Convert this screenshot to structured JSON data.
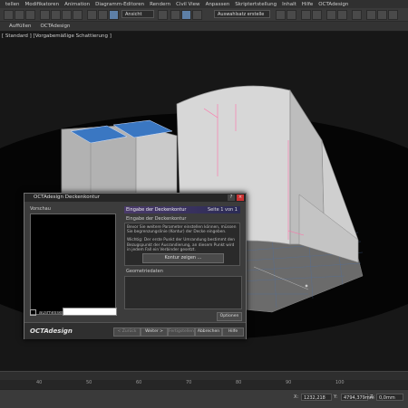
{
  "menubar": {
    "items": [
      "tellen",
      "Modifikatoren",
      "Animation",
      "Diagramm-Editoren",
      "Rendern",
      "Civil View",
      "Anpassen",
      "Skriptertstellung",
      "Inhalt",
      "Hilfe",
      "OCTAdesign"
    ]
  },
  "toolbar": {
    "view_select": "Ansicht",
    "selection_set": "Auswahlsatz erstelle"
  },
  "tabs": {
    "items": [
      "Auffüllen",
      "OCTAdesign"
    ]
  },
  "viewport": {
    "label": "[ Standard ] [Vorgabemäßige Schattierung ]"
  },
  "timeline": {
    "ticks": [
      "40",
      "50",
      "60",
      "70",
      "80",
      "90",
      "100"
    ]
  },
  "status": {
    "x_label": "X:",
    "x_value": "1232,218",
    "y_label": "Y:",
    "y_value": "4794,379mm",
    "z_label": "Z:",
    "z_value": "0,0mm"
  },
  "dialog": {
    "title": "OCTAdesign Deckenkontur",
    "preview_label": "Vorschau",
    "step_header": "Eingabe der Deckenkontur",
    "step_page": "Seite 1 von 1",
    "step_subtitle": "Eingabe der Deckenkontur",
    "info1": "Bevor Sie weitere Parameter einstellen können, müssen Sie begrenzungslinie (Kontur) der Decke eingeben.",
    "info2": "Wichtig: Der erste Punkt der Umrandung bestimmt den Bezugspunkt der Ausrandierung, an diesem Punkt wird in jedem Fall ein Verbinder gesetzt.",
    "contour_button": "Kontur zeigen ...",
    "geometry_label": "Geometriedaten",
    "checkbox_label": "ausmessen",
    "options_button": "Optionen ...",
    "logo": "OCTAdesign",
    "back_button": "< Zurück",
    "next_button": "Weiter >",
    "finish_button": "Fertigstellen",
    "cancel_button": "Abbrechen",
    "help_button": "Hilfe"
  },
  "colors": {
    "accent": "#5d7fa6",
    "step_header": "#4a3a6a",
    "floor_grid": "#4a6fa8"
  }
}
